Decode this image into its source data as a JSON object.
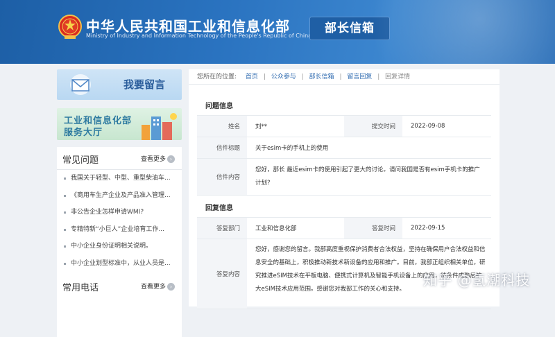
{
  "header": {
    "org_cn": "中华人民共和国工业和信息化部",
    "org_en": "Ministry of Industry and Information Technology of the People's Republic of China",
    "mailbox_label": "部长信箱",
    "colors": {
      "primary": "#2a73c0",
      "accent": "#1f5fa5"
    }
  },
  "sidebar": {
    "write_message": "我要留言",
    "service_hall": {
      "line1": "工业和信息化部",
      "line2": "服务大厅"
    },
    "faq": {
      "title": "常见问题",
      "more": "查看更多",
      "items": [
        "我国关于轻型、中型、重型柴油车...",
        "《商用车生产企业及产品准入管理...",
        "非公告企业怎样申请WMI?",
        "专精特新“小巨人”企业培育工作...",
        "中小企业身份证明相关说明。",
        "中小企业划型标准中，从业人员是..."
      ]
    },
    "phone": {
      "title": "常用电话",
      "more": "查看更多"
    }
  },
  "breadcrumb": {
    "prefix": "您所在的位置:",
    "items": [
      "首页",
      "公众参与",
      "部长信箱",
      "留言回复"
    ],
    "current": "回复详情"
  },
  "question": {
    "section_title": "问题信息",
    "name_label": "姓名",
    "name_value": "刘**",
    "date_label": "提交时间",
    "date_value": "2022-09-08",
    "subject_label": "信件标题",
    "subject_value": "关于esim卡的手机上的使用",
    "content_label": "信件内容",
    "content_value": "您好，部长 最近esim卡的使用引起了更大的讨论。请问我国是否有esim手机卡的推广计划?"
  },
  "reply": {
    "section_title": "回复信息",
    "dept_label": "答复部门",
    "dept_value": "工业和信息化部",
    "date_label": "答复时间",
    "date_value": "2022-09-15",
    "content_label": "答复内容",
    "content_value": "您好，感谢您的留言。我部高度重视保护消费者合法权益，坚持在确保用户合法权益和信息安全的基础上，积极推动新技术新设备的应用和推广。目前，我部正组织相关单位，研究推进eSIM技术在平板电脑、便携式计算机及智能手机设备上的应用，待条件成熟后扩大eSIM技术应用范围。感谢您对我部工作的关心和支持。"
  },
  "watermark": "知乎 @氢潮科技"
}
